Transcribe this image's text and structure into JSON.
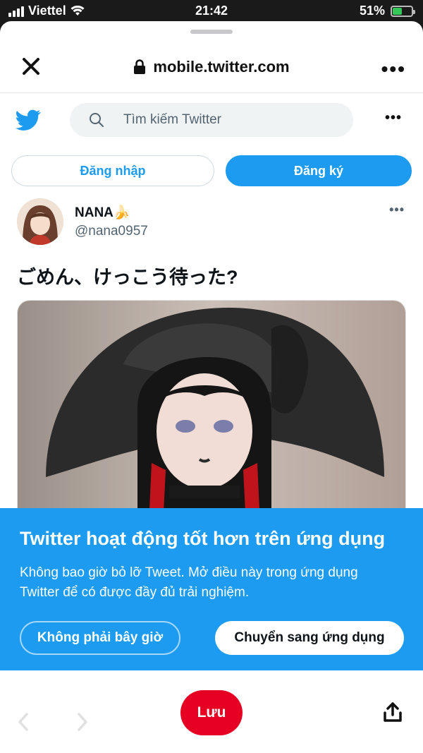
{
  "status_bar": {
    "carrier": "Viettel",
    "time": "21:42",
    "battery": "51%",
    "battery_level": 0.51
  },
  "browser": {
    "url": "mobile.twitter.com"
  },
  "twitter": {
    "search_placeholder": "Tìm kiếm Twitter",
    "login_label": "Đăng nhập",
    "signup_label": "Đăng ký"
  },
  "tweet": {
    "name": "NANA🍌",
    "handle": "@nana0957",
    "text": "ごめん、けっこう待った?"
  },
  "app_banner": {
    "title": "Twitter hoạt động tốt hơn trên ứng dụng",
    "description": "Không bao giờ bỏ lỡ Tweet. Mở điều này trong ứng dụng Twitter để có được đầy đủ trải nghiệm.",
    "later_label": "Không phải bây giờ",
    "open_label": "Chuyển sang ứng dụng"
  },
  "toolbar": {
    "save_label": "Lưu"
  },
  "colors": {
    "twitter_blue": "#1d9bf0",
    "save_red": "#e60023"
  }
}
